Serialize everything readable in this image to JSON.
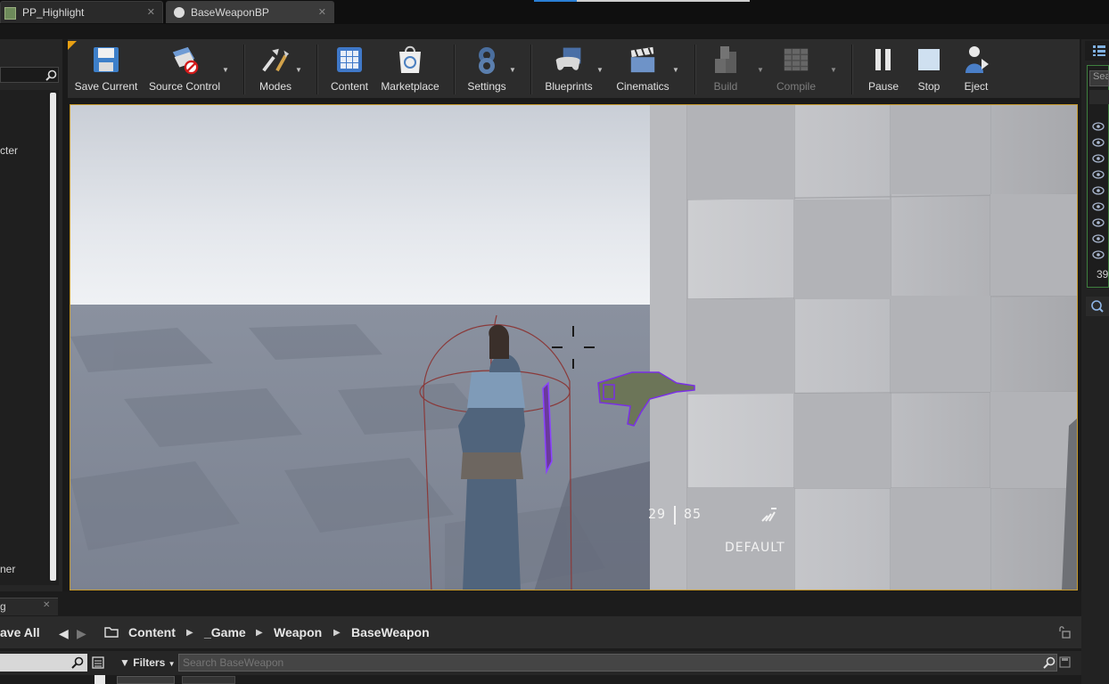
{
  "tabs": [
    {
      "label": "PP_Highlight"
    },
    {
      "label": "BaseWeaponBP"
    }
  ],
  "left_panel": {
    "item_1": "cter",
    "item_2": "ner"
  },
  "toolbar": {
    "save_current": "Save Current",
    "source_control": "Source Control",
    "modes": "Modes",
    "content": "Content",
    "marketplace": "Marketplace",
    "settings": "Settings",
    "blueprints": "Blueprints",
    "cinematics": "Cinematics",
    "build": "Build",
    "compile": "Compile",
    "pause": "Pause",
    "stop": "Stop",
    "eject": "Eject"
  },
  "viewport": {
    "ammo_clip": "29",
    "ammo_reserve": "85",
    "fire_mode": "DEFAULT"
  },
  "right_panel": {
    "search_placeholder": "Sea",
    "count": "39"
  },
  "bottom": {
    "tab_label": "g",
    "save_all": "ave All",
    "breadcrumb": [
      "Content",
      "_Game",
      "Weapon",
      "BaseWeapon"
    ],
    "filters_label": "Filters",
    "search_placeholder": "Search BaseWeapon"
  }
}
